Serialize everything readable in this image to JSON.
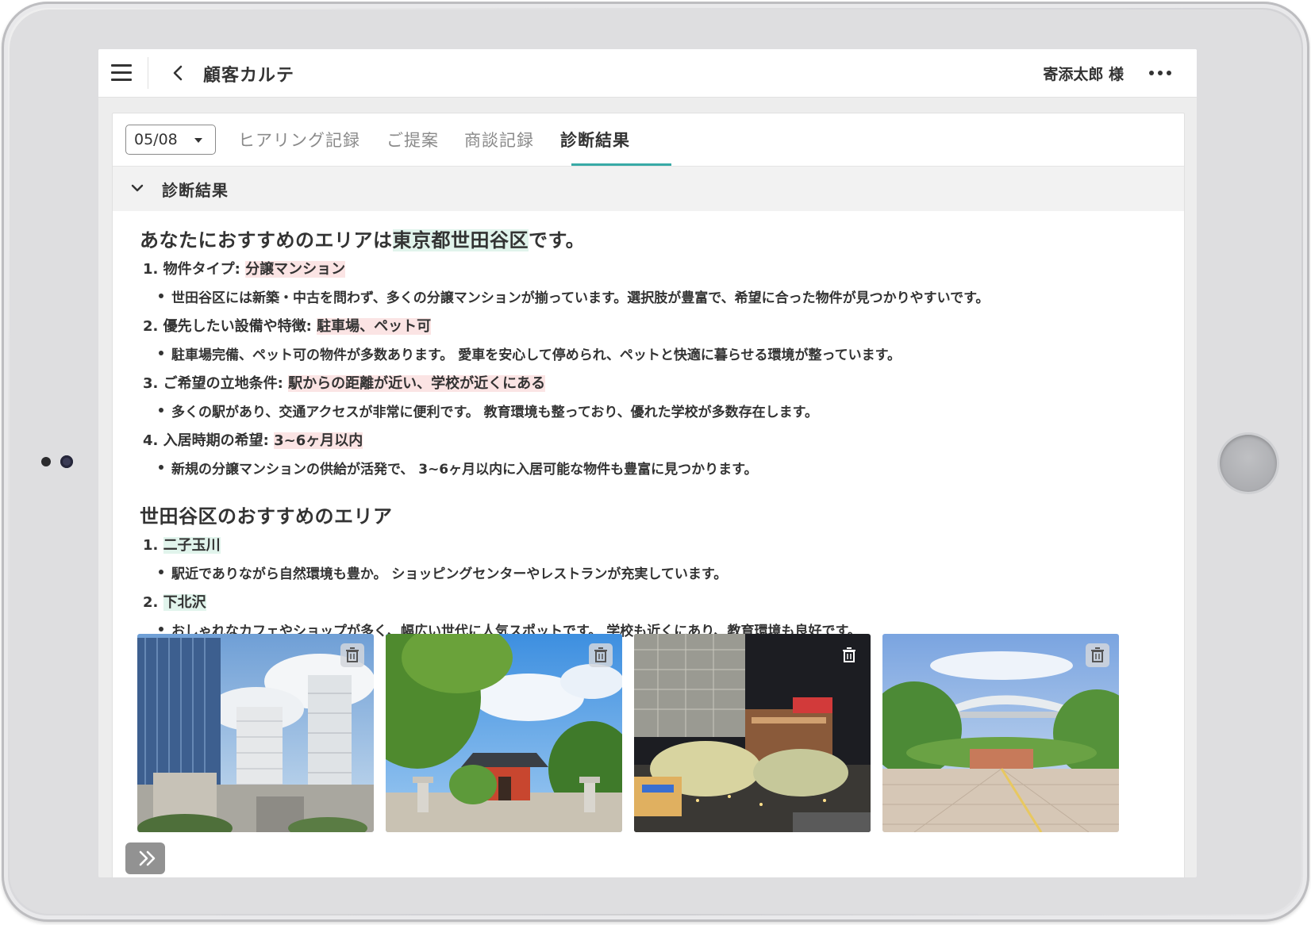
{
  "app": {
    "title": "顧客カルテ",
    "customer_name": "寄添太郎 様"
  },
  "tabs": {
    "date_value": "05/08",
    "items": [
      {
        "label": "ヒアリング記録"
      },
      {
        "label": "ご提案"
      },
      {
        "label": "商談記録"
      },
      {
        "label": "診断結果",
        "active": true
      }
    ]
  },
  "section": {
    "title": "診断結果"
  },
  "diagnosis": {
    "heading_prefix": "あなたにおすすめのエリアは",
    "heading_area": "東京都世田谷区",
    "heading_suffix": "です。",
    "items": [
      {
        "label": "1. 物件タイプ: ",
        "value": "分譲マンション",
        "detail": "世田谷区には新築・中古を問わず、多くの分譲マンションが揃っています。選択肢が豊富で、希望に合った物件が見つかりやすいです。"
      },
      {
        "label": "2. 優先したい設備や特徴: ",
        "value": "駐車場、ペット可",
        "detail": "駐車場完備、ペット可の物件が多数あります。 愛車を安心して停められ、ペットと快適に暮らせる環境が整っています。"
      },
      {
        "label": "3. ご希望の立地条件: ",
        "value": "駅からの距離が近い、学校が近くにある",
        "detail": "多くの駅があり、交通アクセスが非常に便利です。 教育環境も整っており、優れた学校が多数存在します。"
      },
      {
        "label": "4. 入居時期の希望: ",
        "value": "3~6ヶ月以内",
        "detail": "新規の分譲マンションの供給が活発で、 3~6ヶ月以内に入居可能な物件も豊富に見つかります。"
      }
    ]
  },
  "areas": {
    "heading": "世田谷区のおすすめのエリア",
    "items": [
      {
        "label": "1. ",
        "value": "二子玉川",
        "detail": "駅近でありながら自然環境も豊か。 ショッピングセンターやレストランが充実しています。"
      },
      {
        "label": "2. ",
        "value": "下北沢",
        "detail": "おしゃれなカフェやショップが多く、幅広い世代に人気スポットです。 学校も近くにあり、教育環境も良好です。"
      }
    ]
  },
  "photos": [
    {
      "subject": "high-rise towers"
    },
    {
      "subject": "shrine with trees"
    },
    {
      "subject": "station plaza at night"
    },
    {
      "subject": "park plaza with bridge"
    }
  ],
  "colors": {
    "accent": "#38aaa6",
    "highlight_green": "#e1f4ec",
    "highlight_pink": "#fbe4e4"
  },
  "icons": [
    "menu-icon",
    "back-icon",
    "more-icon",
    "chevron-down-icon",
    "caret-down-icon",
    "trash-icon",
    "expand-icon"
  ]
}
